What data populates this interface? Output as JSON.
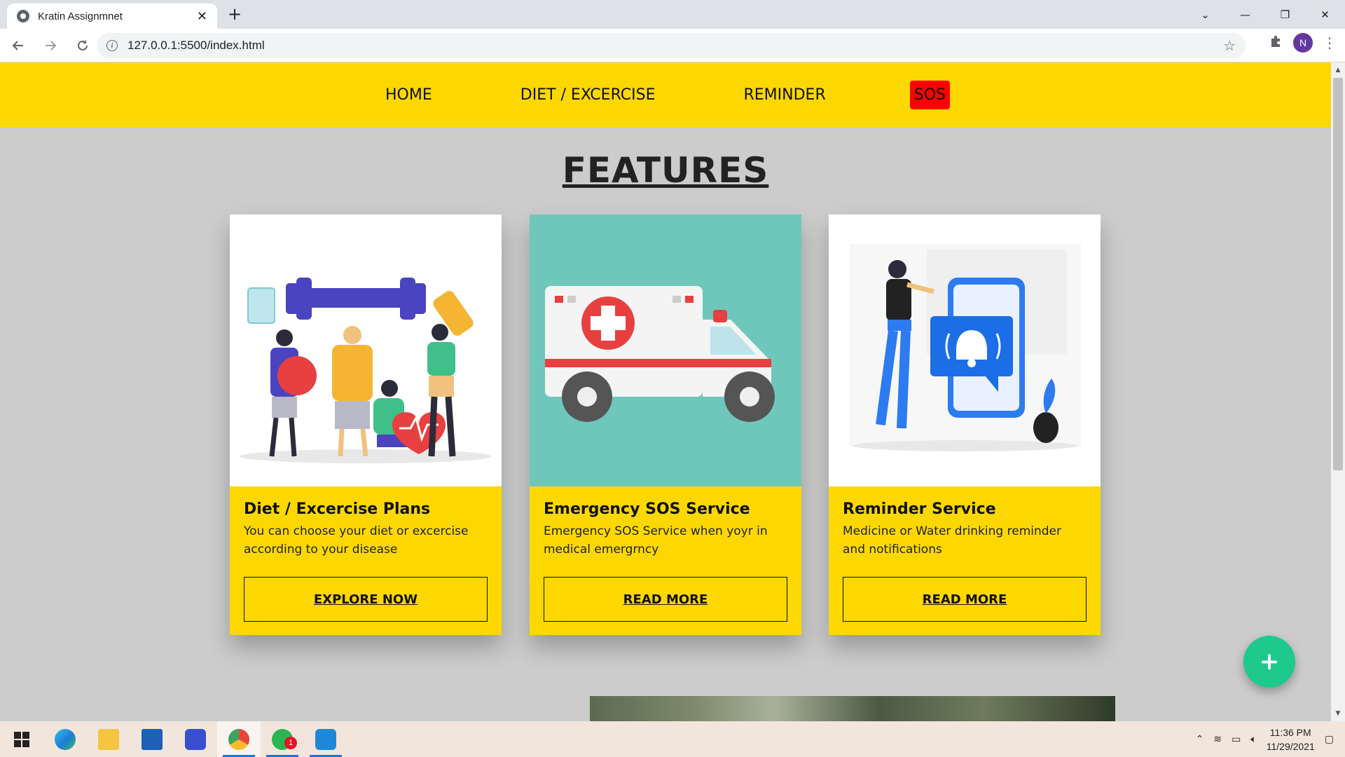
{
  "browser": {
    "tab_title": "Kratin Assignmnet",
    "tab_close": "✕",
    "new_tab": "+",
    "url": "127.0.0.1:5500/index.html",
    "profile_initial": "N",
    "window_controls": [
      "⌄",
      "—",
      "❐",
      "✕"
    ]
  },
  "site_nav": {
    "items": [
      {
        "label": "HOME"
      },
      {
        "label": "DIET / EXCERCISE"
      },
      {
        "label": "REMINDER"
      },
      {
        "label": "SOS"
      }
    ]
  },
  "features": {
    "title": "FEATURES",
    "cards": [
      {
        "title": "Diet / Excercise Plans",
        "description": "You can choose your diet or excercise according to your disease",
        "button": "EXPLORE NOW",
        "art_bg": "#ffffff"
      },
      {
        "title": "Emergency SOS Service",
        "description": "Emergency SOS Service when yoyr in medical emergrncy",
        "button": "READ MORE",
        "art_bg": "#6fc7bb"
      },
      {
        "title": "Reminder Service",
        "description": "Medicine or Water drinking reminder and notifications",
        "button": "READ MORE",
        "art_bg": "#ffffff"
      }
    ]
  },
  "fab": {
    "label": "+"
  },
  "colors": {
    "nav_bg": "#fcd800",
    "sos_bg": "#ff0000",
    "fab_bg": "#1ec98d",
    "page_bg": "#cccccc"
  },
  "taskbar": {
    "time": "11:36 PM",
    "date": "11/29/2021",
    "whatsapp_badge": "1"
  }
}
